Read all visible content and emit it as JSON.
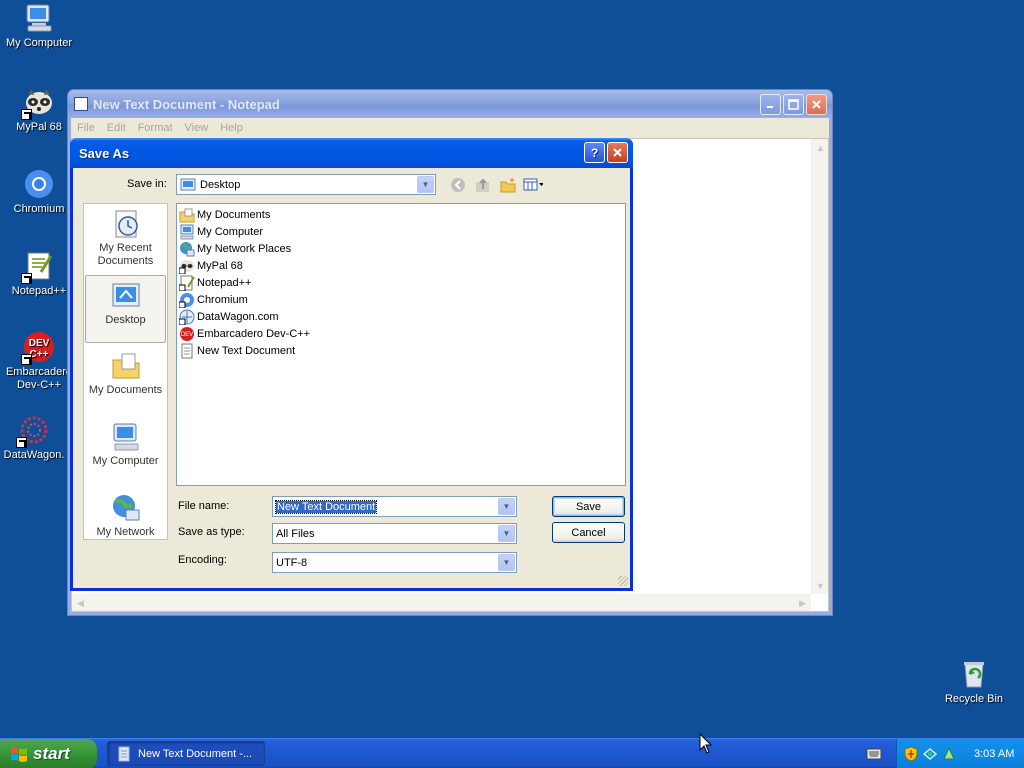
{
  "desktop": {
    "icons": [
      {
        "label": "My Computer"
      },
      {
        "label": "MyPal 68"
      },
      {
        "label": "Chromium"
      },
      {
        "label": "Notepad++"
      },
      {
        "label": "Embarcadero Dev-C++"
      },
      {
        "label": "DataWagon."
      },
      {
        "label": "Recycle Bin"
      }
    ]
  },
  "notepad": {
    "title": "New Text Document - Notepad",
    "menu": [
      "File",
      "Edit",
      "Format",
      "View",
      "Help"
    ]
  },
  "dialog": {
    "title": "Save As",
    "save_in_label": "Save in:",
    "save_in_value": "Desktop",
    "places": [
      {
        "label": "My Recent Documents"
      },
      {
        "label": "Desktop"
      },
      {
        "label": "My Documents"
      },
      {
        "label": "My Computer"
      },
      {
        "label": "My Network"
      }
    ],
    "files": [
      {
        "name": "My Documents"
      },
      {
        "name": "My Computer"
      },
      {
        "name": "My Network Places"
      },
      {
        "name": "MyPal 68"
      },
      {
        "name": "Notepad++"
      },
      {
        "name": "Chromium"
      },
      {
        "name": "DataWagon.com"
      },
      {
        "name": "Embarcadero Dev-C++"
      },
      {
        "name": "New Text Document"
      }
    ],
    "file_name_label": "File name:",
    "file_name_value": "New Text Document",
    "save_as_type_label": "Save as type:",
    "save_as_type_value": "All Files",
    "encoding_label": "Encoding:",
    "encoding_value": "UTF-8",
    "save_button": "Save",
    "cancel_button": "Cancel",
    "help_button": "?",
    "close_button": "X"
  },
  "taskbar": {
    "start_label": "start",
    "task_label": "New Text Document -...",
    "clock": "3:03 AM"
  },
  "colors": {
    "desktop": "#0e4f98",
    "titlebar_active": "#0058e6",
    "taskbar": "#245edb",
    "start_button": "#3c9a3c",
    "selection": "#316ac5"
  }
}
